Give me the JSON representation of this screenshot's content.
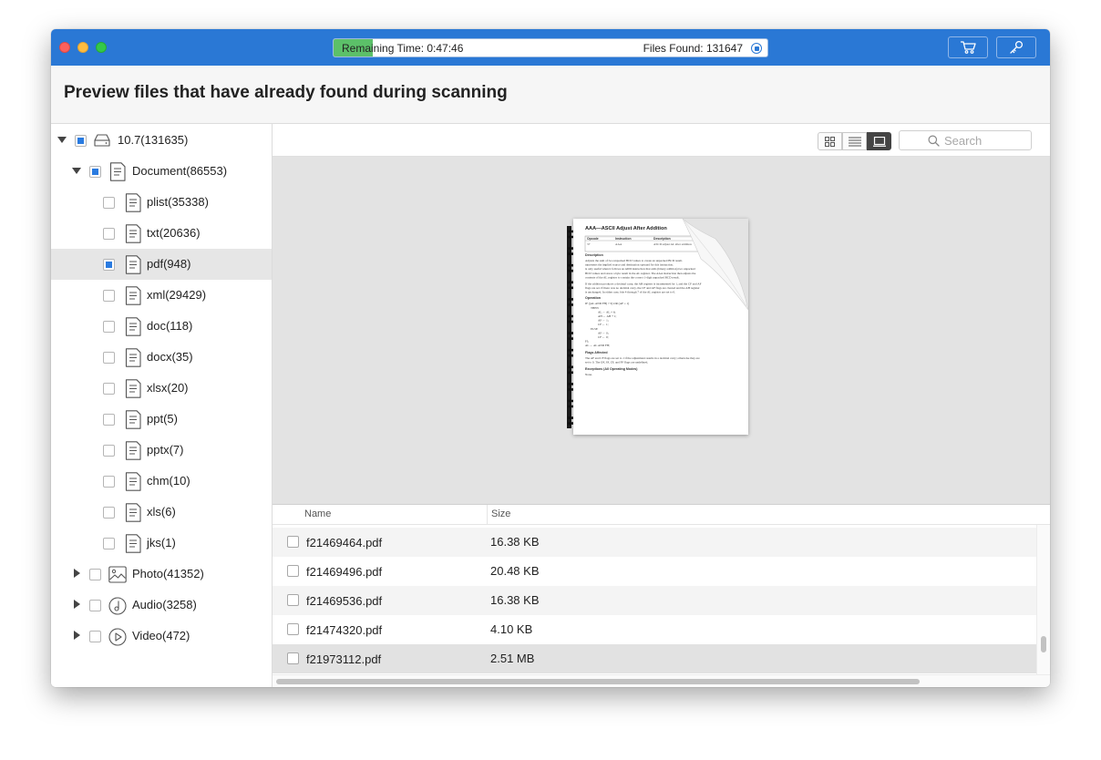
{
  "scan": {
    "remaining_time": "Remaining Time: 0:47:46",
    "files_found": "Files Found: 131647",
    "progress_percent": 9
  },
  "header": {
    "title": "Preview files that have already found during scanning"
  },
  "tree": {
    "root": {
      "label": "10.7(131635)",
      "icon": "drive-icon",
      "checked": "partial"
    },
    "document": {
      "label": "Document(86553)",
      "icon": "document-icon",
      "checked": "partial"
    },
    "doc_items": [
      {
        "label": "plist(35338)",
        "checked": false
      },
      {
        "label": "txt(20636)",
        "checked": false
      },
      {
        "label": "pdf(948)",
        "checked": "partial",
        "selected": true
      },
      {
        "label": "xml(29429)",
        "checked": false
      },
      {
        "label": "doc(118)",
        "checked": false
      },
      {
        "label": "docx(35)",
        "checked": false
      },
      {
        "label": "xlsx(20)",
        "checked": false
      },
      {
        "label": "ppt(5)",
        "checked": false
      },
      {
        "label": "pptx(7)",
        "checked": false
      },
      {
        "label": "chm(10)",
        "checked": false
      },
      {
        "label": "xls(6)",
        "checked": false
      },
      {
        "label": "jks(1)",
        "checked": false
      }
    ],
    "categories": [
      {
        "label": "Photo(41352)",
        "icon": "photo-icon"
      },
      {
        "label": "Audio(3258)",
        "icon": "audio-icon"
      },
      {
        "label": "Video(472)",
        "icon": "video-icon"
      }
    ]
  },
  "search": {
    "placeholder": "Search"
  },
  "view_modes": [
    "grid-view-icon",
    "list-view-icon",
    "preview-view-icon"
  ],
  "active_view": "preview-view-icon",
  "file_list": {
    "columns": {
      "name": "Name",
      "size": "Size"
    },
    "rows": [
      {
        "name": "f21469464.pdf",
        "size": "16.38 KB"
      },
      {
        "name": "f21469496.pdf",
        "size": "20.48 KB"
      },
      {
        "name": "f21469536.pdf",
        "size": "16.38 KB"
      },
      {
        "name": "f21474320.pdf",
        "size": "4.10 KB"
      },
      {
        "name": "f21973112.pdf",
        "size": "2.51 MB"
      }
    ]
  },
  "preview_doc": {
    "title": "AAA—ASCII Adjust After Addition",
    "table_headers": [
      "Opcode",
      "Instruction",
      "Description"
    ],
    "table_row": [
      "37",
      "AAA",
      "ASCII adjust AL after addition"
    ],
    "sections": [
      "Description",
      "Operation",
      "Flags Affected",
      "Exceptions (All Operating Modes)"
    ],
    "description_lines": [
      "Adjusts the sum of two unpacked BCD values to create an unpacked BCD result.",
      "represents the implied source and destination operand for this instruction.",
      "is only useful when it follows an ADD instruction that adds (binary addition) two unpacked",
      "BCD values and stores a byte result in the AL register. The AAA instruction then adjusts the",
      "contents of the AL register to contain the correct 1-digit unpacked BCD result.",
      "If the addition produces a decimal carry, the AH register is incremented by 1, and the CF and AF",
      "flags are set. If there was no decimal carry, the CF and AF flags are cleared and the AH register",
      "is unchanged. In either case, bits 4 through 7 of the AL register are set to 0."
    ],
    "operation_lines": [
      "IF ((AL AND FH) > 9) OR (AF = 1)",
      "THEN",
      "AL ← AL + 6;",
      "AH ← AH + 1;",
      "AF ← 1;",
      "CF ← 1;",
      "ELSE",
      "AF ← 0;",
      "CF ← 0;",
      "FI;",
      "AL ← AL AND FH;"
    ],
    "flags_lines": [
      "The AF and CF flags are set to 1 if the adjustment results in a decimal carry; otherwise they are",
      "set to 0. The OF, SF, ZF, and PF flags are undefined."
    ],
    "exceptions_text": "None."
  }
}
